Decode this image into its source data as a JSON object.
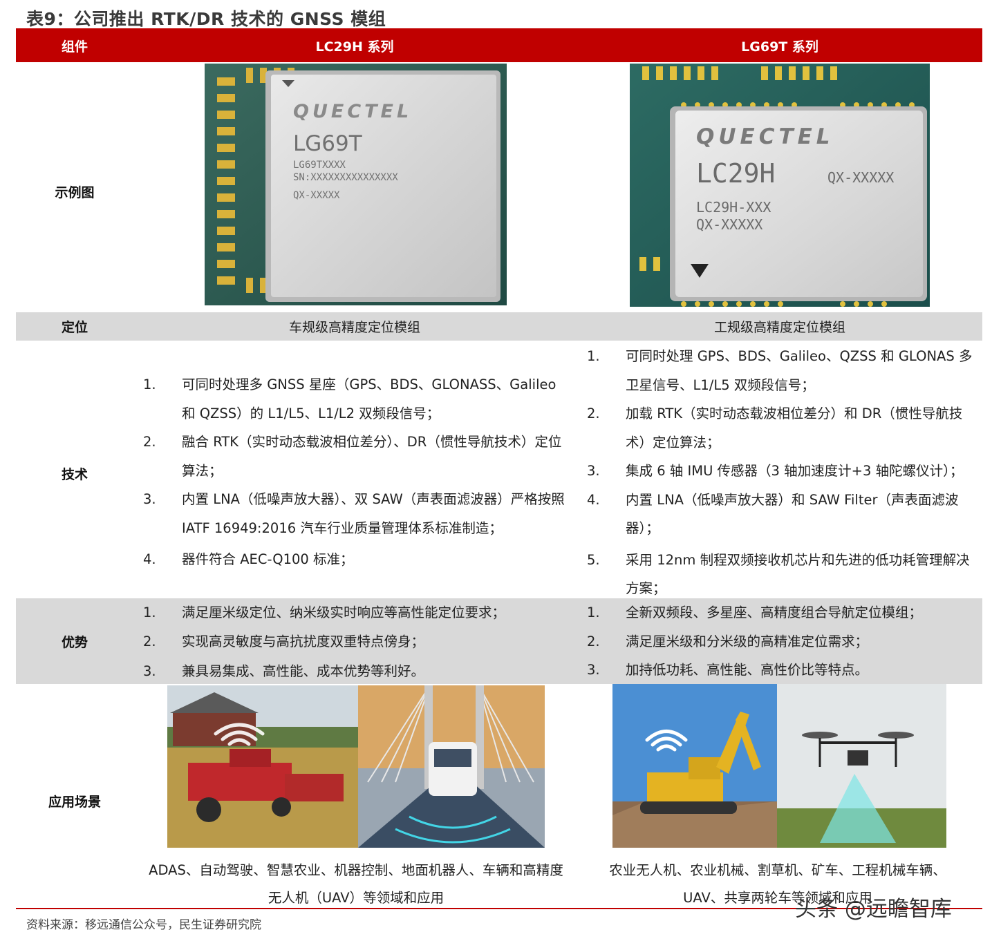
{
  "title": "表9：公司推出 RTK/DR 技术的 GNSS 模组",
  "header": {
    "col0": "组件",
    "col1": "LC29H 系列",
    "col2": "LG69T 系列"
  },
  "rows": {
    "image": {
      "label": "示例图"
    },
    "positioning": {
      "label": "定位",
      "col1": "车规级高精度定位模组",
      "col2": "工规级高精度定位模组"
    },
    "technology": {
      "label": "技术"
    },
    "advantages": {
      "label": "优势"
    },
    "applications": {
      "label": "应用场景"
    }
  },
  "chip_left": {
    "brand": "QUECTEL",
    "model": "LG69T",
    "line1": "LG69TXXXX",
    "line2": "SN:XXXXXXXXXXXXXXX",
    "line3": "QX-XXXXX"
  },
  "chip_right": {
    "brand": "QUECTEL",
    "model": "LC29H",
    "code": "QX-XXXXX",
    "line1": "LC29H-XXX",
    "line2": "QX-XXXXX"
  },
  "tech_left": [
    {
      "num": "1.",
      "text": "可同时处理多 GNSS 星座（GPS、BDS、GLONASS、Galileo 和 QZSS）的 L1/L5、L1/L2 双频段信号；"
    },
    {
      "num": "2.",
      "text": "融合 RTK（实时动态载波相位差分）、DR（惯性导航技术）定位算法；"
    },
    {
      "num": "3.",
      "text": "内置 LNA（低噪声放大器）、双 SAW（声表面滤波器）严格按照 IATF 16949:2016 汽车行业质量管理体系标准制造；"
    },
    {
      "num": "4.",
      "text": "器件符合 AEC-Q100 标准；"
    }
  ],
  "tech_right": [
    {
      "num": "1.",
      "text": "可同时处理 GPS、BDS、Galileo、QZSS 和 GLONAS 多卫星信号、L1/L5 双频段信号；"
    },
    {
      "num": "2.",
      "text": "加载 RTK（实时动态载波相位差分）和 DR（惯性导航技术）定位算法；"
    },
    {
      "num": "3.",
      "text": "集成 6 轴 IMU 传感器（3 轴加速度计+3 轴陀螺仪计）；"
    },
    {
      "num": "4.",
      "text": "内置 LNA（低噪声放大器）和 SAW Filter（声表面滤波器）；"
    },
    {
      "num": "5.",
      "text": "采用 12nm 制程双频接收机芯片和先进的低功耗管理解决方案；"
    }
  ],
  "adv_left": [
    {
      "num": "1.",
      "text": "满足厘米级定位、纳米级实时响应等高性能定位要求；"
    },
    {
      "num": "2.",
      "text": "实现高灵敏度与高抗扰度双重特点傍身；"
    },
    {
      "num": "3.",
      "text": "兼具易集成、高性能、成本优势等利好。"
    }
  ],
  "adv_right": [
    {
      "num": "1.",
      "text": "全新双频段、多星座、高精度组合导航定位模组；"
    },
    {
      "num": "2.",
      "text": "满足厘米级和分米级的高精准定位需求；"
    },
    {
      "num": "3.",
      "text": "加持低功耗、高性能、高性价比等特点。"
    }
  ],
  "app_left_caption": "ADAS、自动驾驶、智慧农业、机器控制、地面机器人、车辆和高精度无人机（UAV）等领域和应用",
  "app_right_caption": "农业无人机、农业机械、割草机、矿车、工程机械车辆、UAV、共享两轮车等领域和应用",
  "source": "资料来源：移远通信公众号，民生证券研究院",
  "watermark": "头条 @远瞻智库",
  "colors": {
    "header": "#c00000",
    "band": "#d9d9d9"
  }
}
